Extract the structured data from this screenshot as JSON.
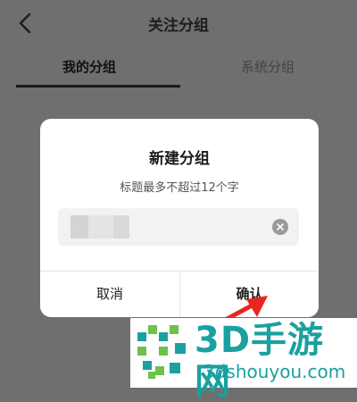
{
  "header": {
    "title": "关注分组"
  },
  "tabs": [
    {
      "label": "我的分组",
      "active": true
    },
    {
      "label": "系统分组",
      "active": false
    }
  ],
  "dialog": {
    "title": "新建分组",
    "subtitle": "标题最多不超过12个字",
    "input_value": "",
    "cancel_label": "取消",
    "confirm_label": "确认"
  },
  "watermark": {
    "brand_text": "3D手游网",
    "url_text": "3dshouyou.com"
  },
  "colors": {
    "overlay_bg": "#6f6f6f",
    "dialog_bg": "#ffffff",
    "annotation_arrow": "#e8261e",
    "watermark_teal": "#1aa0a0"
  },
  "icons": {
    "back": "chevron-left-icon",
    "clear": "clear-circle-icon",
    "annotation": "red-arrow-icon",
    "watermark_logo": "brand-logo-icon"
  }
}
